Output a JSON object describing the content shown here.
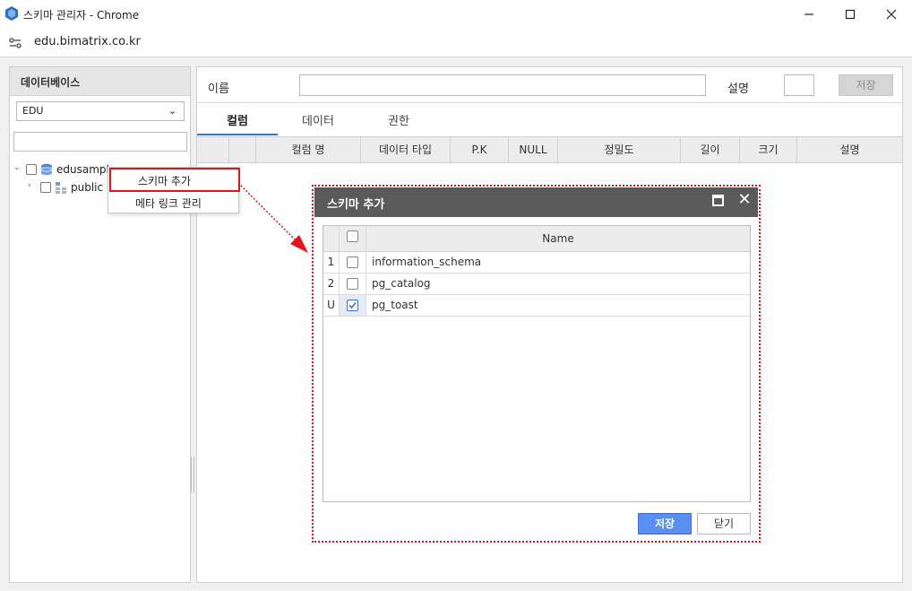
{
  "window": {
    "title": "스키마 관리자 - Chrome",
    "url": "edu.bimatrix.co.kr"
  },
  "left": {
    "header": "데이터베이스",
    "db_selected": "EDU",
    "search_value": "",
    "tree": [
      {
        "label": "edusample",
        "expanded": true
      },
      {
        "label": "public",
        "expanded": false
      }
    ]
  },
  "context_menu": {
    "items": [
      "스키마 추가",
      "메타 링크 관리"
    ]
  },
  "right": {
    "name_label": "이름",
    "name_value": "",
    "desc_label": "설명",
    "desc_value": "",
    "save_label": "저장",
    "tabs": [
      "컬럼",
      "데이터",
      "권한"
    ],
    "columns": [
      "",
      "",
      "컬럼 명",
      "데이터 타입",
      "P.K",
      "NULL",
      "정밀도",
      "길이",
      "크기",
      "설명"
    ]
  },
  "modal": {
    "title": "스키마 추가",
    "column_header": "Name",
    "rows": [
      {
        "index": "1",
        "checked": false,
        "name": "information_schema"
      },
      {
        "index": "2",
        "checked": false,
        "name": "pg_catalog"
      },
      {
        "index": "U",
        "checked": true,
        "name": "pg_toast"
      }
    ],
    "save_label": "저장",
    "close_label": "닫기"
  },
  "colors": {
    "accent": "#3a74d8",
    "primary_button": "#5a8ef0",
    "highlight": "#e0161b",
    "modal_header": "#5a5a5a"
  }
}
